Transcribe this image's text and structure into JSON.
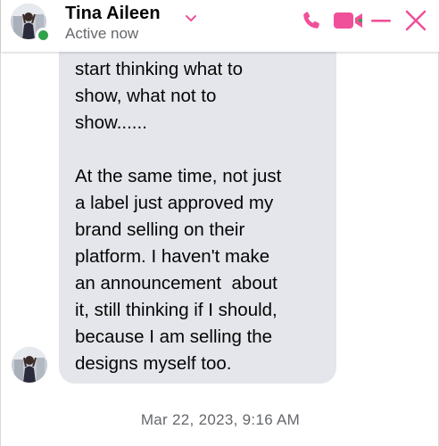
{
  "header": {
    "contact_name": "Tina Aileen",
    "status": "Active now",
    "icons": {
      "chevron": "chevron-down-icon",
      "call": "phone-icon",
      "video": "video-camera-icon",
      "minimize": "minimize-icon",
      "close": "close-icon"
    }
  },
  "conversation": {
    "message": "start thinking what to\nshow, what not to\nshow......\n\nAt the same time, not just\na label just approved my\nbrand selling on their\nplatform. I haven't make\nan announcement  about\nit, still thinking if I should,\nbecause I am selling the\ndesigns myself too.",
    "timestamp": "Mar 22, 2023, 9:16 AM"
  },
  "colors": {
    "accent": "#f0509a",
    "bubble": "#e4e6eb",
    "online": "#31a24c",
    "secondary_text": "#65676b"
  }
}
